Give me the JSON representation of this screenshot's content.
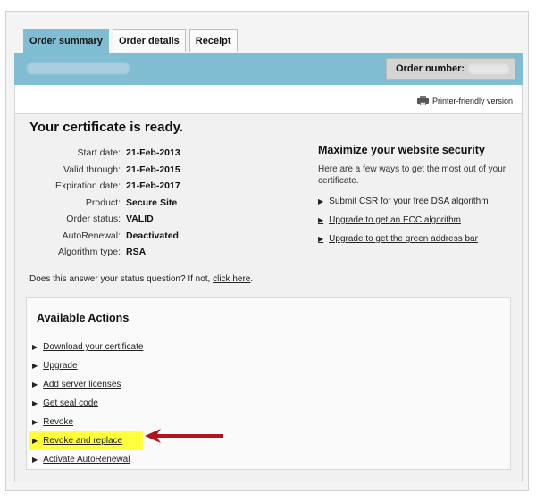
{
  "tabs": [
    {
      "label": "Order summary",
      "active": true
    },
    {
      "label": "Order details",
      "active": false
    },
    {
      "label": "Receipt",
      "active": false
    }
  ],
  "header": {
    "order_number_label": "Order number:"
  },
  "printer": {
    "label": "Printer-friendly version",
    "icon": "printer-icon"
  },
  "certificate": {
    "title": "Your certificate is ready.",
    "details": [
      {
        "label": "Start date:",
        "value": "21-Feb-2013"
      },
      {
        "label": "Valid through:",
        "value": "21-Feb-2015"
      },
      {
        "label": "Expiration date:",
        "value": "21-Feb-2017"
      },
      {
        "label": "Product:",
        "value": "Secure Site"
      },
      {
        "label": "Order status:",
        "value": "VALID"
      },
      {
        "label": "AutoRenewal:",
        "value": "Deactivated"
      },
      {
        "label": "Algorithm type:",
        "value": "RSA"
      }
    ]
  },
  "maximize": {
    "title": "Maximize your website security",
    "text": "Here are a few ways to get the most out of your certificate.",
    "links": [
      "Submit CSR for your free DSA algorithm",
      "Upgrade to get an ECC algorithm",
      "Upgrade to get the green address bar"
    ]
  },
  "status_question": {
    "text": "Does this answer your status question? If not, ",
    "link": "click here",
    "suffix": "."
  },
  "actions": {
    "title": "Available Actions",
    "items": [
      "Download your certificate",
      "Upgrade",
      "Add server licenses",
      "Get seal code",
      "Revoke",
      "Revoke and replace",
      "Activate AutoRenewal"
    ],
    "highlighted_index": 5
  },
  "colors": {
    "header": "#80bdd3",
    "highlight": "#ffff3c",
    "arrow": "#b0141c"
  }
}
